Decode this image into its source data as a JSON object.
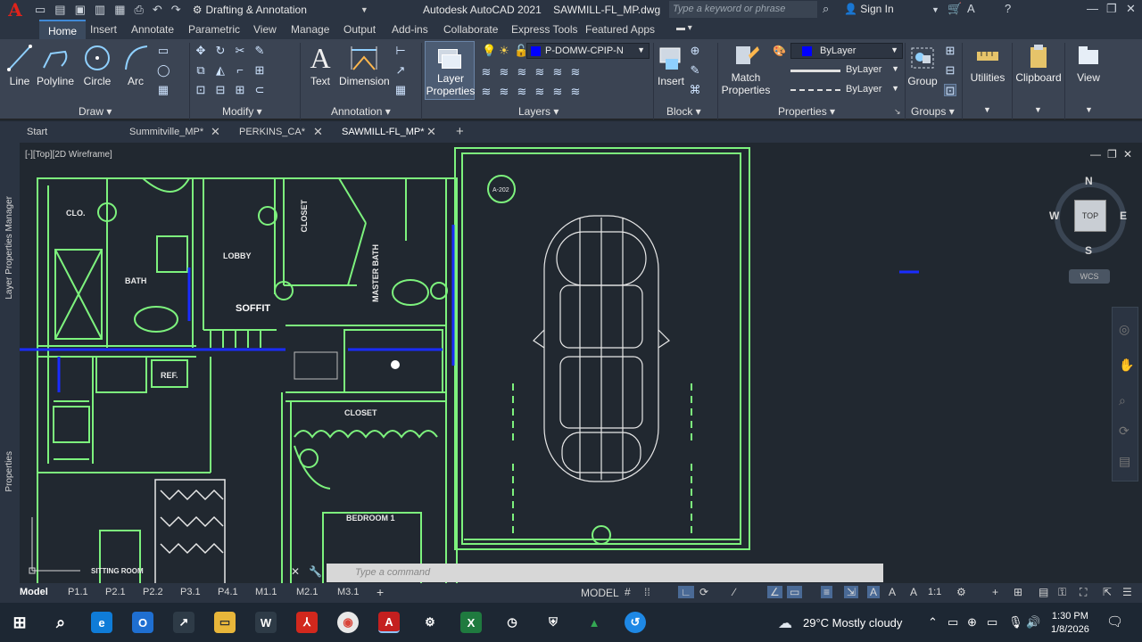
{
  "titlebar": {
    "workspace": "Drafting & Annotation",
    "app_title": "Autodesk AutoCAD 2021",
    "file_name": "SAWMILL-FL_MP.dwg",
    "search_placeholder": "Type a keyword or phrase",
    "sign_in": "Sign In"
  },
  "ribbon_tabs": [
    "Home",
    "Insert",
    "Annotate",
    "Parametric",
    "View",
    "Manage",
    "Output",
    "Add-ins",
    "Collaborate",
    "Express Tools",
    "Featured Apps"
  ],
  "ribbon": {
    "draw": {
      "title": "Draw",
      "tools": [
        "Line",
        "Polyline",
        "Circle",
        "Arc"
      ]
    },
    "modify": {
      "title": "Modify"
    },
    "annotation": {
      "title": "Annotation",
      "tools": [
        "Text",
        "Dimension"
      ]
    },
    "layers": {
      "title": "Layers",
      "layer_props_1": "Layer",
      "layer_props_2": "Properties",
      "current_layer": "P-DOMW-CPIP-N"
    },
    "block": {
      "title": "Block",
      "insert": "Insert"
    },
    "properties": {
      "title": "Properties",
      "match_1": "Match",
      "match_2": "Properties",
      "color": "ByLayer",
      "lineweight": "ByLayer",
      "linetype": "ByLayer"
    },
    "groups": {
      "title": "Groups",
      "group": "Group"
    },
    "utilities": "Utilities",
    "clipboard": "Clipboard",
    "view": "View"
  },
  "doc_tabs": [
    {
      "label": "Start"
    },
    {
      "label": "Summitville_MP*"
    },
    {
      "label": "PERKINS_CA*"
    },
    {
      "label": "SAWMILL-FL_MP*"
    }
  ],
  "viewport": {
    "label": "[-][Top][2D Wireframe]",
    "side_panels": [
      "Layer Properties Manager",
      "Properties"
    ],
    "viewcube": {
      "n": "N",
      "s": "S",
      "e": "E",
      "w": "W",
      "face": "TOP",
      "ucs": "WCS"
    },
    "command_placeholder": "Type a command",
    "plan_labels": {
      "clo": "CLO.",
      "bath": "BATH",
      "lobby": "LOBBY",
      "soffit": "SOFFIT",
      "closet1": "CLOSET",
      "closet2": "CLOSET",
      "master_bath": "MASTER BATH",
      "ref": "REF.",
      "bedroom": "BEDROOM 1",
      "sitting": "SITTING ROOM",
      "a202": "A-202"
    }
  },
  "layout_tabs": [
    "Model",
    "P1.1",
    "P2.1",
    "P2.2",
    "P3.1",
    "P4.1",
    "M1.1",
    "M2.1",
    "M3.1"
  ],
  "status": {
    "model": "MODEL",
    "scale": "1:1"
  },
  "taskbar": {
    "weather": "29°C  Mostly cloudy",
    "time": "1:30 PM",
    "date": "1/8/2026"
  },
  "colors": {
    "plan_line": "#7df27d",
    "plan_accent": "#1a2cff",
    "background": "#212830",
    "ribbon": "#3b4453"
  }
}
